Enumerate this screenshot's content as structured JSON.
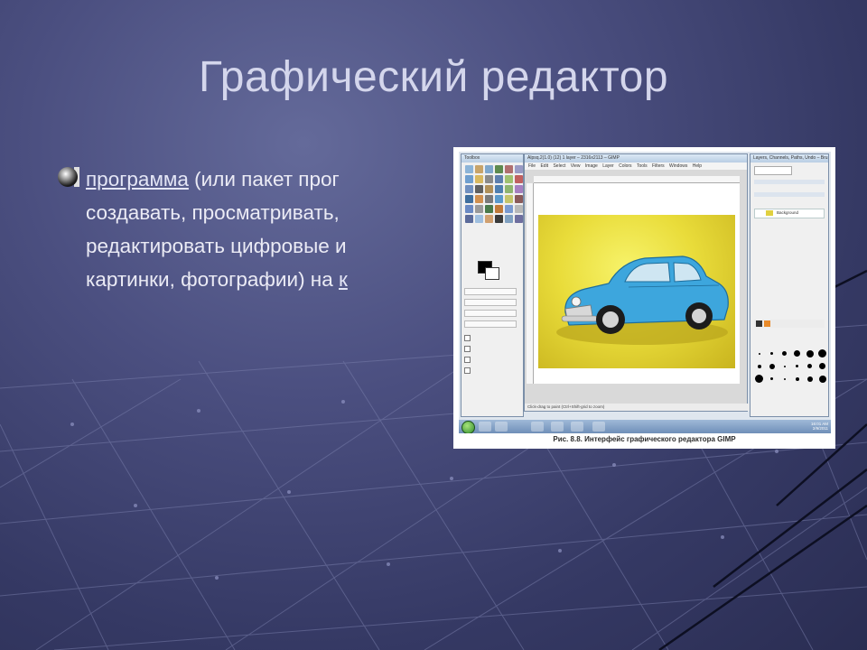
{
  "slide": {
    "title": "Графический редактор",
    "bullet": {
      "link_text": "программа",
      "line1_rest": " (или пакет прог",
      "line2": "создавать, просматривать,",
      "line3": "редактировать цифровые и",
      "line4_start": "картинки, фотографии) на ",
      "line4_link": "к"
    }
  },
  "figure": {
    "caption": "Рис. 8.8. Интерфейс графического редактора GIMP",
    "toolbox_title": "Toolbox",
    "image_window_title": "Alpsq.2(1.0) (12) 1 layer – 2316x2113 – GIMP",
    "menu_items": [
      "File",
      "Edit",
      "Select",
      "View",
      "Image",
      "Layer",
      "Colors",
      "Tools",
      "Filters",
      "Windows",
      "Help"
    ],
    "layers_title": "Layers, Channels, Paths, Undo – Bru",
    "layer_name": "Background",
    "status_text": "Click-drag to paint (Ctrl+Shift-grid to zoom)",
    "tray_time": "16:01 AM",
    "tray_date": "2/9/2011"
  },
  "colors": {
    "background": "#3c4070",
    "title": "#d4d6ec",
    "text": "#ebebf5",
    "grid_lines": "#7b80ad",
    "car_body": "#3da6dd",
    "photo_bg": "#eadd3c"
  }
}
